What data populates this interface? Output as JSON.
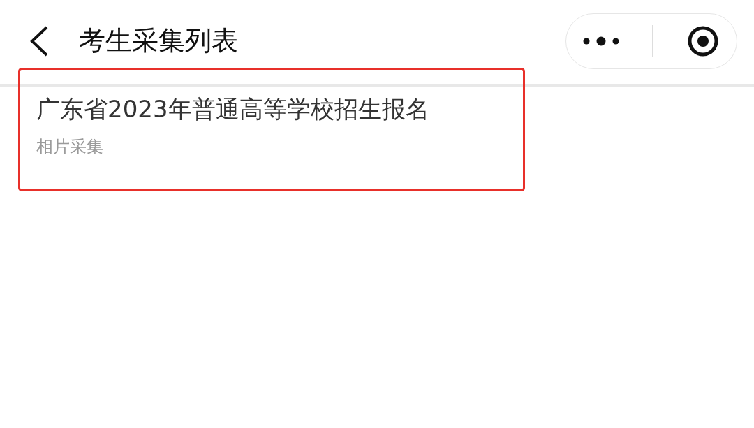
{
  "header": {
    "title": "考生采集列表"
  },
  "items": [
    {
      "title": "广东省2023年普通高等学校招生报名",
      "subtitle": "相片采集",
      "highlighted": true
    }
  ]
}
